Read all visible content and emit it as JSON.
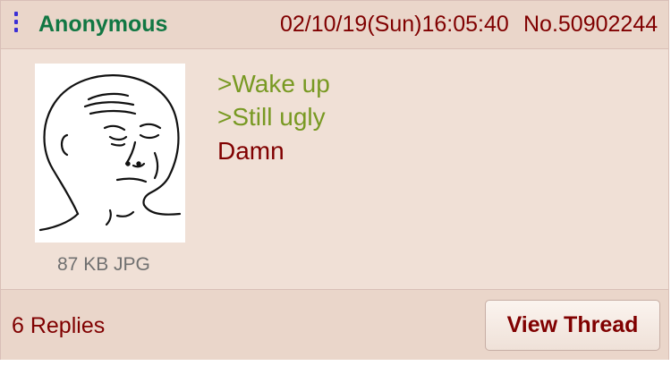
{
  "post": {
    "author": "Anonymous",
    "datetime": "02/10/19(Sun)16:05:40",
    "number": "No.50902244",
    "file_info": "87 KB JPG",
    "lines": [
      {
        "text": ">Wake up",
        "style": "greentext"
      },
      {
        "text": ">Still ugly",
        "style": "greentext"
      },
      {
        "text": "Damn",
        "style": "normal"
      }
    ],
    "thumbnail": "wojak-sad-face-drawing"
  },
  "footer": {
    "replies": "6 Replies",
    "view_thread": "View Thread"
  },
  "colors": {
    "background": "#f0e0d6",
    "header": "#ead6ca",
    "name_green": "#117743",
    "maroon": "#800000",
    "greentext": "#789922",
    "menu_blue": "#3b2fd6"
  },
  "icons": {
    "menu": "vertical-dots-icon"
  }
}
